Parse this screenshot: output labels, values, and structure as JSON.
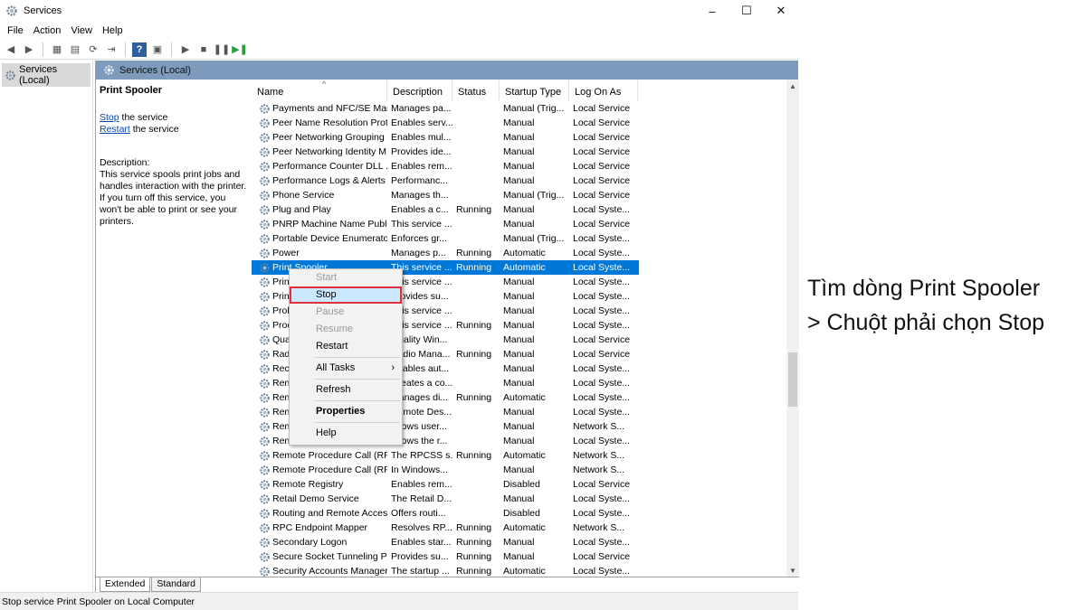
{
  "window": {
    "title": "Services",
    "controls": [
      "–",
      "☐",
      "✕"
    ]
  },
  "menu": [
    "File",
    "Action",
    "View",
    "Help"
  ],
  "tree": {
    "root_label": "Services (Local)"
  },
  "pane_header": "Services (Local)",
  "detail": {
    "title": "Print Spooler",
    "stop_link": "Stop",
    "stop_suffix": " the service",
    "restart_link": "Restart",
    "restart_suffix": " the service",
    "desc_label": "Description:",
    "desc_text": "This service spools print jobs and handles interaction with the printer. If you turn off this service, you won't be able to print or see your printers."
  },
  "columns": [
    "Name",
    "Description",
    "Status",
    "Startup Type",
    "Log On As"
  ],
  "rows": [
    [
      "Payments and NFC/SE Man...",
      "Manages pa...",
      "",
      "Manual (Trig...",
      "Local Service"
    ],
    [
      "Peer Name Resolution Prot...",
      "Enables serv...",
      "",
      "Manual",
      "Local Service"
    ],
    [
      "Peer Networking Grouping",
      "Enables mul...",
      "",
      "Manual",
      "Local Service"
    ],
    [
      "Peer Networking Identity M...",
      "Provides ide...",
      "",
      "Manual",
      "Local Service"
    ],
    [
      "Performance Counter DLL ...",
      "Enables rem...",
      "",
      "Manual",
      "Local Service"
    ],
    [
      "Performance Logs & Alerts",
      "Performanc...",
      "",
      "Manual",
      "Local Service"
    ],
    [
      "Phone Service",
      "Manages th...",
      "",
      "Manual (Trig...",
      "Local Service"
    ],
    [
      "Plug and Play",
      "Enables a c...",
      "Running",
      "Manual",
      "Local Syste..."
    ],
    [
      "PNRP Machine Name Publi...",
      "This service ...",
      "",
      "Manual",
      "Local Service"
    ],
    [
      "Portable Device Enumerator...",
      "Enforces gr...",
      "",
      "Manual (Trig...",
      "Local Syste..."
    ],
    [
      "Power",
      "Manages p...",
      "Running",
      "Automatic",
      "Local Syste..."
    ],
    [
      "Print Spooler",
      "This service ...",
      "Running",
      "Automatic",
      "Local Syste..."
    ],
    [
      "Prin",
      "This service ...",
      "",
      "Manual",
      "Local Syste..."
    ],
    [
      "Prin",
      "Provides su...",
      "",
      "Manual",
      "Local Syste..."
    ],
    [
      "Prol",
      "This service ...",
      "",
      "Manual",
      "Local Syste..."
    ],
    [
      "Proc",
      "This service ...",
      "Running",
      "Manual",
      "Local Syste..."
    ],
    [
      "Qua",
      "Quality Win...",
      "",
      "Manual",
      "Local Service"
    ],
    [
      "Rad",
      "Radio Mana...",
      "Running",
      "Manual",
      "Local Service"
    ],
    [
      "Rec",
      "Enables aut...",
      "",
      "Manual",
      "Local Syste..."
    ],
    [
      "Ren",
      "Creates a co...",
      "",
      "Manual",
      "Local Syste..."
    ],
    [
      "Ren",
      "Manages di...",
      "Running",
      "Automatic",
      "Local Syste..."
    ],
    [
      "Ren",
      "Remote Des...",
      "",
      "Manual",
      "Local Syste..."
    ],
    [
      "Ren",
      "Allows user...",
      "",
      "Manual",
      "Network S..."
    ],
    [
      "Ren",
      "Allows the r...",
      "",
      "Manual",
      "Local Syste..."
    ],
    [
      "Remote Procedure Call (RPC)",
      "The RPCSS s...",
      "Running",
      "Automatic",
      "Network S..."
    ],
    [
      "Remote Procedure Call (RP...",
      "In Windows...",
      "",
      "Manual",
      "Network S..."
    ],
    [
      "Remote Registry",
      "Enables rem...",
      "",
      "Disabled",
      "Local Service"
    ],
    [
      "Retail Demo Service",
      "The Retail D...",
      "",
      "Manual",
      "Local Syste..."
    ],
    [
      "Routing and Remote Access",
      "Offers routi...",
      "",
      "Disabled",
      "Local Syste..."
    ],
    [
      "RPC Endpoint Mapper",
      "Resolves RP...",
      "Running",
      "Automatic",
      "Network S..."
    ],
    [
      "Secondary Logon",
      "Enables star...",
      "Running",
      "Manual",
      "Local Syste..."
    ],
    [
      "Secure Socket Tunneling Pr...",
      "Provides su...",
      "Running",
      "Manual",
      "Local Service"
    ],
    [
      "Security Accounts Manager",
      "The startup ...",
      "Running",
      "Automatic",
      "Local Syste..."
    ]
  ],
  "selected_row_index": 11,
  "context_menu": {
    "start": "Start",
    "stop": "Stop",
    "pause": "Pause",
    "resume": "Resume",
    "restart": "Restart",
    "all_tasks": "All Tasks",
    "refresh": "Refresh",
    "properties": "Properties",
    "help": "Help"
  },
  "tabs": [
    "Extended",
    "Standard"
  ],
  "status_bar": "Stop service Print Spooler on Local Computer",
  "annotation": {
    "line1": "Tìm dòng Print Spooler",
    "line2": "> Chuột phải chọn Stop"
  },
  "colors": {
    "selection": "#0078d7",
    "pane_header": "#7e9bbd",
    "highlight_border": "#e0303e",
    "link": "#0645ad"
  }
}
